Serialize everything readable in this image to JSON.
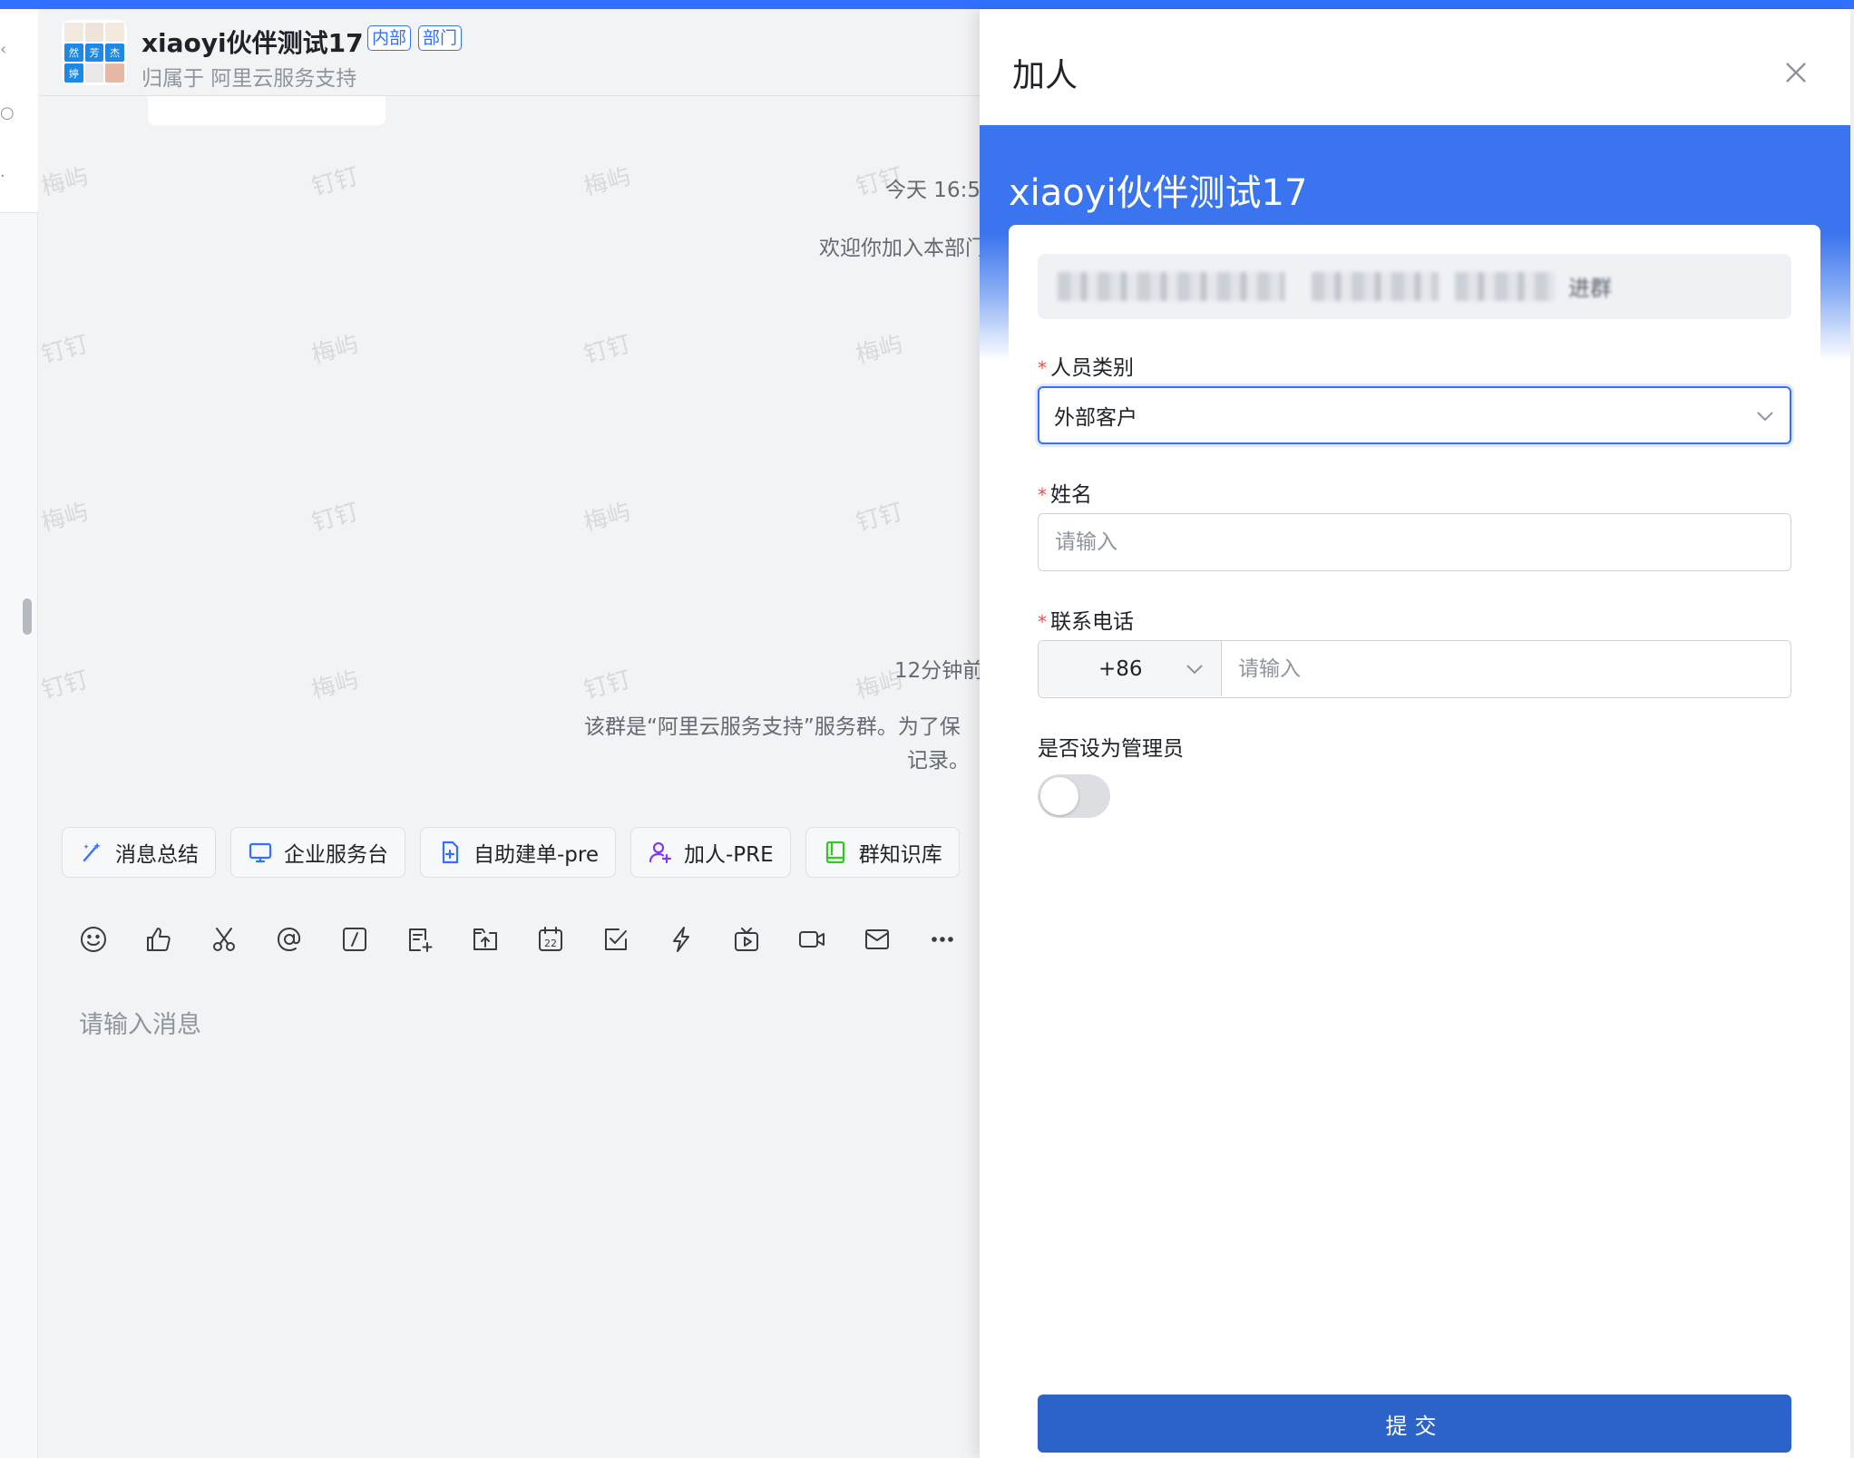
{
  "chat": {
    "title": "xiaoyi伙伴测试17",
    "tags": [
      "内部",
      "部门"
    ],
    "subtitle": "归属于 阿里云服务支持",
    "avatar_chars": [
      "",
      "",
      "",
      "然",
      "芳",
      "杰",
      "婷",
      "",
      ""
    ],
    "watermarks": [
      "梅屿",
      "钉钉"
    ],
    "messages": [
      {
        "type": "time",
        "text": "今天 16:5"
      },
      {
        "type": "system",
        "text": "欢迎你加入本部门"
      },
      {
        "type": "time",
        "text": "12分钟前"
      },
      {
        "type": "system",
        "lines": [
          "该群是“阿里云服务支持”服务群。为了保",
          "记录。"
        ]
      }
    ],
    "shortcuts": [
      {
        "label": "消息总结",
        "icon": "magic-wand-icon",
        "color": "#3370ff"
      },
      {
        "label": "企业服务台",
        "icon": "monitor-icon",
        "color": "#3370ff"
      },
      {
        "label": "自助建单-pre",
        "icon": "document-add-icon",
        "color": "#3370ff"
      },
      {
        "label": "加人-PRE",
        "icon": "user-add-icon",
        "color": "#7f3bf5"
      },
      {
        "label": "群知识库",
        "icon": "book-icon",
        "color": "#34c724"
      }
    ],
    "toolbar": [
      "emoji-icon",
      "thumbs-up-icon",
      "scissors-icon",
      "at-icon",
      "slash-icon",
      "note-add-icon",
      "upload-icon",
      "calendar-icon",
      "checkbox-icon",
      "flash-icon",
      "live-icon",
      "video-icon",
      "mail-icon",
      "more-icon"
    ],
    "calendar_day": "22",
    "input_placeholder": "请输入消息"
  },
  "drawer": {
    "title": "加人",
    "banner_title": "xiaoyi伙伴测试17",
    "group_info_text": "进群",
    "fields": {
      "category": {
        "label": "人员类别",
        "required": true,
        "value": "外部客户"
      },
      "name": {
        "label": "姓名",
        "required": true,
        "placeholder": "请输入"
      },
      "phone": {
        "label": "联系电话",
        "required": true,
        "country_code": "+86",
        "placeholder": "请输入"
      },
      "admin": {
        "label": "是否设为管理员",
        "required": false,
        "on": false
      }
    },
    "submit_label": "提交"
  },
  "colors": {
    "accent": "#3370ff",
    "banner": "#3a74ee",
    "submit": "#2b63c8",
    "required": "#f54a45"
  }
}
